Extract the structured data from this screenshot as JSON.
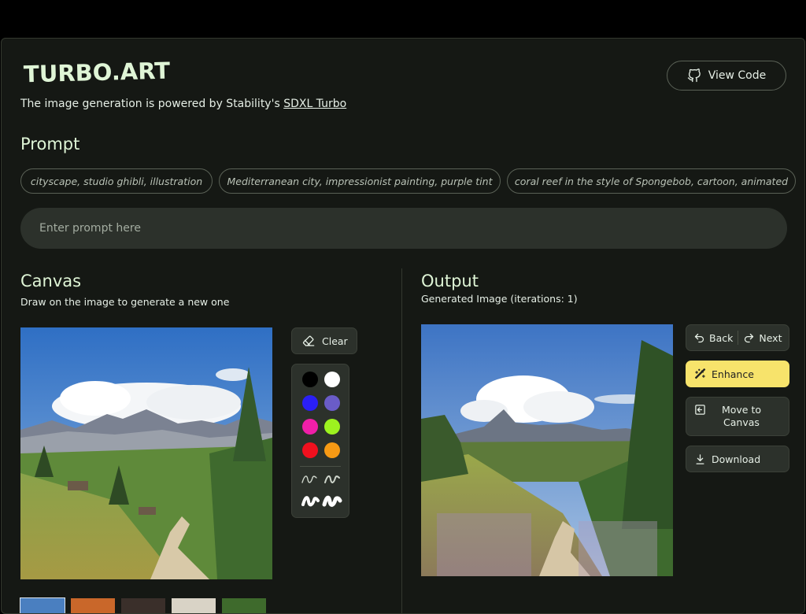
{
  "header": {
    "logo": "TURBO.ART",
    "tagline_prefix": "The image generation is powered by Stability's ",
    "tagline_link": "SDXL Turbo",
    "view_code_label": "View Code"
  },
  "prompt_section": {
    "title": "Prompt",
    "suggestions": [
      "cityscape, studio ghibli, illustration",
      "Mediterranean city, impressionist painting, purple tint",
      "coral reef in the style of Spongebob, cartoon, animated"
    ],
    "input_value": "",
    "input_placeholder": "Enter prompt here"
  },
  "canvas": {
    "title": "Canvas",
    "subtitle": "Draw on the image to generate a new one",
    "clear_label": "Clear",
    "colors": [
      "#000000",
      "#ffffff",
      "#2a1ff5",
      "#6a5cc8",
      "#f01fa8",
      "#9df21f",
      "#f0101e",
      "#f79a14"
    ]
  },
  "output": {
    "title": "Output",
    "subtitle": "Generated Image (iterations: 1)",
    "back_label": "Back",
    "next_label": "Next",
    "enhance_label": "Enhance",
    "move_label": "Move to Canvas",
    "download_label": "Download"
  },
  "icons": {
    "github": "github-icon",
    "eraser": "eraser-icon",
    "undo": "undo-icon",
    "redo": "redo-icon",
    "wand": "magic-wand-icon",
    "move": "move-to-canvas-icon",
    "download": "download-icon",
    "thin_brush": "thin-brush-icon",
    "thick_brush": "thick-brush-icon"
  },
  "colors": {
    "background": "#151814",
    "panel": "#2c312b",
    "accent_yellow": "#f7e36b",
    "text": "#e6efe6",
    "logo": "#dff5d6"
  }
}
